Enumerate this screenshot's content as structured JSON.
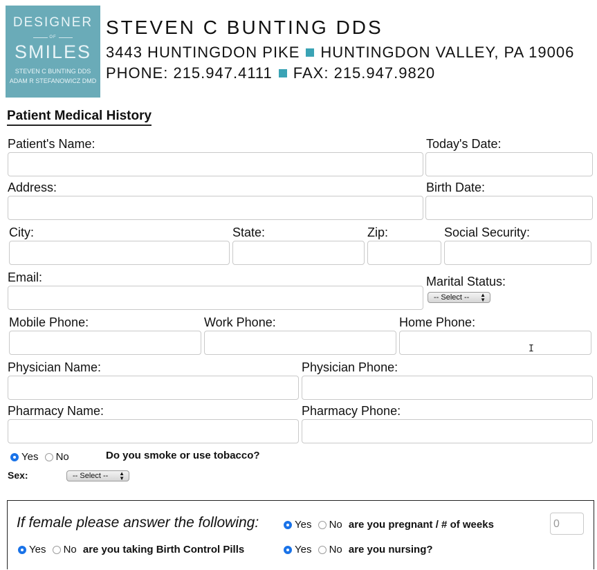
{
  "header": {
    "logo": {
      "line1": "DESIGNER",
      "line2": "OF",
      "line3": "SMILES",
      "line4": "STEVEN C BUNTING DDS",
      "line5": "ADAM R STEFANOWICZ DMD"
    },
    "practice_name": "STEVEN C BUNTING DDS",
    "address_street": "3443 HUNTINGDON PIKE",
    "address_city": "HUNTINGDON VALLEY, PA 19006",
    "phone": "PHONE: 215.947.4111",
    "fax": "FAX: 215.947.9820",
    "accent_color": "#3aa3b5",
    "logo_color": "#6aabb8"
  },
  "form": {
    "title": "Patient Medical History",
    "fields": {
      "patient_name": {
        "label": "Patient's Name:",
        "value": ""
      },
      "todays_date": {
        "label": "Today's Date:",
        "value": ""
      },
      "address": {
        "label": "Address:",
        "value": ""
      },
      "birth_date": {
        "label": "Birth Date:",
        "value": ""
      },
      "city": {
        "label": "City:",
        "value": ""
      },
      "state": {
        "label": "State:",
        "value": ""
      },
      "zip": {
        "label": "Zip:",
        "value": ""
      },
      "social_security": {
        "label": "Social Security:",
        "value": ""
      },
      "email": {
        "label": "Email:",
        "value": ""
      },
      "marital_status": {
        "label": "Marital Status:",
        "selected": "-- Select --"
      },
      "mobile_phone": {
        "label": "Mobile Phone:",
        "value": ""
      },
      "work_phone": {
        "label": "Work Phone:",
        "value": ""
      },
      "home_phone": {
        "label": "Home Phone:",
        "value": ""
      },
      "physician_name": {
        "label": "Physician Name:",
        "value": ""
      },
      "physician_phone": {
        "label": "Physician Phone:",
        "value": ""
      },
      "pharmacy_name": {
        "label": "Pharmacy Name:",
        "value": ""
      },
      "pharmacy_phone": {
        "label": "Pharmacy Phone:",
        "value": ""
      },
      "sex": {
        "label": "Sex:",
        "selected": "-- Select --"
      }
    },
    "tobacco": {
      "yes": "Yes",
      "no": "No",
      "question": "Do you smoke or use tobacco?",
      "selected": "yes"
    },
    "female_section": {
      "title": "If female please answer the following:",
      "pregnant": {
        "yes": "Yes",
        "no": "No",
        "question": "are you pregnant / # of weeks",
        "selected": "yes",
        "weeks_placeholder": "0"
      },
      "birth_control": {
        "yes": "Yes",
        "no": "No",
        "question": "are you taking Birth Control Pills",
        "selected": "yes"
      },
      "nursing": {
        "yes": "Yes",
        "no": "No",
        "question": "are you nursing?",
        "selected": "yes"
      }
    }
  }
}
